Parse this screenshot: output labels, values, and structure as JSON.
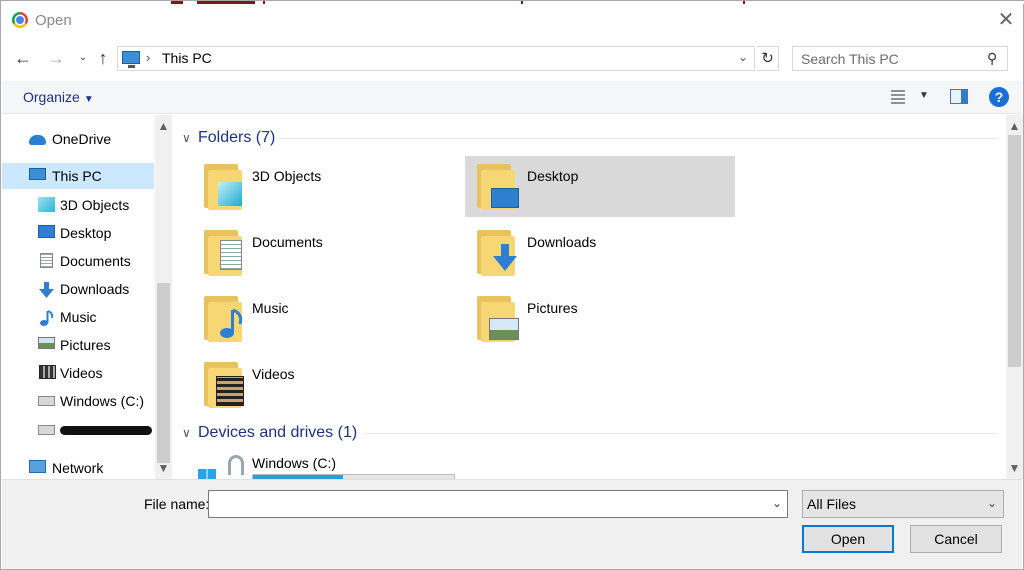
{
  "window": {
    "title": "Open"
  },
  "address": {
    "location": "This PC",
    "search_placeholder": "Search This PC"
  },
  "toolbar": {
    "organize_label": "Organize"
  },
  "nav": {
    "items": [
      {
        "label": "OneDrive",
        "icon": "onedrive-icon"
      },
      {
        "label": "This PC",
        "icon": "this-pc-icon",
        "selected": true
      },
      {
        "label": "3D Objects",
        "icon": "3d-objects-icon"
      },
      {
        "label": "Desktop",
        "icon": "desktop-icon"
      },
      {
        "label": "Documents",
        "icon": "documents-icon"
      },
      {
        "label": "Downloads",
        "icon": "downloads-icon"
      },
      {
        "label": "Music",
        "icon": "music-icon"
      },
      {
        "label": "Pictures",
        "icon": "pictures-icon"
      },
      {
        "label": "Videos",
        "icon": "videos-icon"
      },
      {
        "label": "Windows (C:)",
        "icon": "drive-icon"
      },
      {
        "label": "Network",
        "icon": "network-icon"
      }
    ]
  },
  "main": {
    "folders_header": "Folders (7)",
    "folders": [
      {
        "label": "3D Objects",
        "icon": "3d-objects-icon"
      },
      {
        "label": "Desktop",
        "icon": "desktop-icon",
        "selected": true
      },
      {
        "label": "Documents",
        "icon": "documents-icon"
      },
      {
        "label": "Downloads",
        "icon": "downloads-icon"
      },
      {
        "label": "Music",
        "icon": "music-icon"
      },
      {
        "label": "Pictures",
        "icon": "pictures-icon"
      },
      {
        "label": "Videos",
        "icon": "videos-icon"
      }
    ],
    "devices_header": "Devices and drives (1)",
    "drives": [
      {
        "label": "Windows (C:)",
        "used_fraction": 0.45,
        "icon": "windows-drive-icon"
      }
    ]
  },
  "bottom": {
    "filename_label": "File name:",
    "filename_value": "",
    "filetype": "All Files",
    "open_label": "Open",
    "cancel_label": "Cancel"
  },
  "colors": {
    "accent": "#0078d7",
    "group_header": "#1e3287",
    "selection": "#cce8ff",
    "drive_bar": "#26a0da"
  }
}
